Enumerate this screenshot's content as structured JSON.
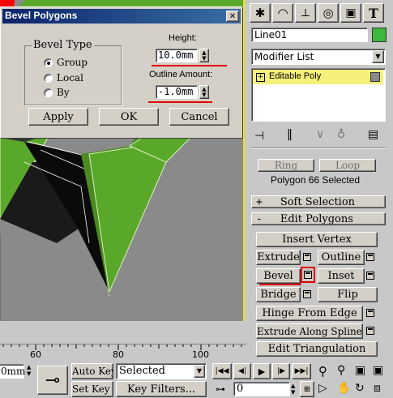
{
  "dialog": {
    "title": "Bevel Polygons",
    "close_glyph": "✕",
    "bevel_type_label": "Bevel Type",
    "options": [
      "Group",
      "Local",
      "By"
    ],
    "selected_option": "Group",
    "height_label": "Height:",
    "height_value": "10.0mm",
    "outline_label": "Outline Amount:",
    "outline_value": "-1.0mm",
    "apply_label": "Apply",
    "ok_label": "OK",
    "cancel_label": "Cancel"
  },
  "panel": {
    "object_name": "Line01",
    "object_color": "#3cb83c",
    "modifier_list_label": "Modifier List",
    "stack_item": "Editable Poly",
    "ring_label": "Ring",
    "loop_label": "Loop",
    "selection_status": "Polygon 66 Selected",
    "soft_selection_label": "Soft Selection",
    "soft_selection_sign": "+",
    "edit_polygons_label": "Edit Polygons",
    "edit_polygons_sign": "-",
    "buttons": {
      "insert_vertex": "Insert Vertex",
      "extrude": "Extrude",
      "outline": "Outline",
      "bevel": "Bevel",
      "inset": "Inset",
      "bridge": "Bridge",
      "flip": "Flip",
      "hinge": "Hinge From Edge",
      "extrude_spline": "Extrude Along Spline",
      "edit_triangulation": "Edit Triangulation"
    }
  },
  "timeline": {
    "ticks": [
      "60",
      "80",
      "100"
    ],
    "coord_value": "0mm",
    "auto_key_label": "Auto Key",
    "set_key_label": "Set Key",
    "selected_value": "Selected",
    "key_filters_label": "Key Filters...",
    "frame_value": "0"
  },
  "colors": {
    "viewport_bg": "#8a8a8a",
    "poly_green": "#5aa82a",
    "poly_red": "#ff0000",
    "highlight_yellow": "#f5f07a",
    "annotation_red": "#e00000",
    "dialog_title_bg": "#0a246a"
  }
}
